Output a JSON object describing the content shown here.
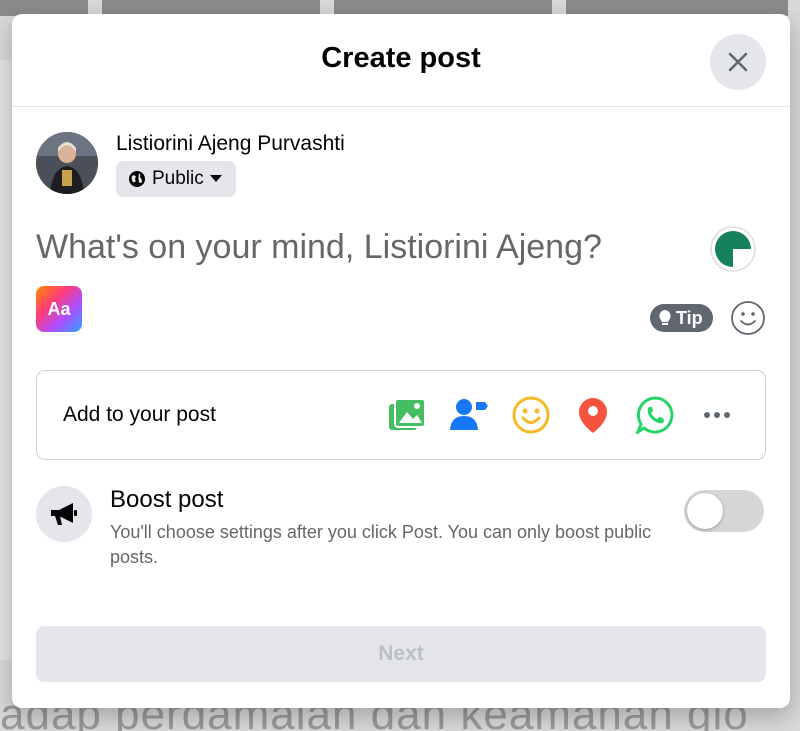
{
  "dialog": {
    "title": "Create post",
    "close_icon": "close-icon"
  },
  "user": {
    "name": "Listiorini Ajeng Purvashti",
    "privacy": "Public"
  },
  "composer": {
    "placeholder": "What's on your mind, Listiorini Ajeng?"
  },
  "background_picker": {
    "label": "Aa"
  },
  "tip": {
    "label": "Tip"
  },
  "add_to_post": {
    "label": "Add to your post",
    "icons": [
      "photo-video-icon",
      "tag-people-icon",
      "feeling-icon",
      "check-in-icon",
      "whatsapp-icon",
      "more-icon"
    ]
  },
  "boost": {
    "title": "Boost post",
    "description": "You'll choose settings after you click Post. You can only boost public posts.",
    "enabled": false
  },
  "footer": {
    "next_label": "Next"
  },
  "background_page": {
    "text": "adap perdamaian dan keamanan glo"
  },
  "colors": {
    "primary_text": "#050505",
    "secondary_text": "#65676b",
    "button_gray": "#e4e6eb",
    "photo_green": "#45bd62",
    "tag_blue": "#1877f2",
    "feeling_yellow": "#f7b928",
    "location_red": "#f5533d",
    "whatsapp_green": "#25d366"
  }
}
